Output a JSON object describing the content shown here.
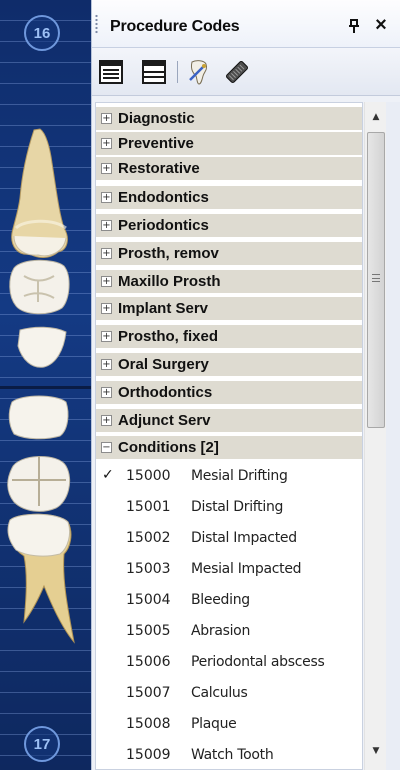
{
  "tooth_chart": {
    "top_tooth_number": "16",
    "bottom_tooth_number": "17"
  },
  "panel": {
    "title": "Procedure Codes",
    "pin_glyph": "ᵖ",
    "close_glyph": "×"
  },
  "toolbar": {
    "buttons": [
      {
        "icon": "list-view-icon"
      },
      {
        "icon": "compact-view-icon"
      },
      {
        "icon": "tooth-tool-icon"
      },
      {
        "icon": "eraser-icon"
      }
    ]
  },
  "tree": {
    "groups": [
      {
        "label": "Diagnostic",
        "expander": "+"
      },
      {
        "label": "Preventive",
        "expander": "+"
      },
      {
        "label": "Restorative",
        "expander": "+"
      },
      {
        "label": "Endodontics",
        "expander": "+"
      },
      {
        "label": "Periodontics",
        "expander": "+"
      },
      {
        "label": "Prosth, remov",
        "expander": "+"
      },
      {
        "label": "Maxillo Prosth",
        "expander": "+"
      },
      {
        "label": "Implant Serv",
        "expander": "+"
      },
      {
        "label": "Prostho, fixed",
        "expander": "+"
      },
      {
        "label": "Oral Surgery",
        "expander": "+"
      },
      {
        "label": "Orthodontics",
        "expander": "+"
      },
      {
        "label": "Adjunct Serv",
        "expander": "+"
      },
      {
        "label": "Conditions [2]",
        "expander": "−"
      }
    ],
    "codes": [
      {
        "code": "15000",
        "description": "Mesial Drifting",
        "check": "✓"
      },
      {
        "code": "15001",
        "description": "Distal Drifting",
        "check": ""
      },
      {
        "code": "15002",
        "description": "Distal Impacted",
        "check": ""
      },
      {
        "code": "15003",
        "description": "Mesial Impacted",
        "check": ""
      },
      {
        "code": "15004",
        "description": "Bleeding",
        "check": ""
      },
      {
        "code": "15005",
        "description": "Abrasion",
        "check": ""
      },
      {
        "code": "15006",
        "description": "Periodontal abscess",
        "check": ""
      },
      {
        "code": "15007",
        "description": "Calculus",
        "check": ""
      },
      {
        "code": "15008",
        "description": "Plaque",
        "check": ""
      },
      {
        "code": "15009",
        "description": "Watch Tooth",
        "check": ""
      }
    ]
  },
  "scrollbar": {
    "up_glyph": "▲",
    "down_glyph": "▼",
    "position_fraction": 0.0
  },
  "colors": {
    "chart_background": "#143a84",
    "group_row": "#dedbd1",
    "tooth_number_ring": "#6f98dd"
  }
}
